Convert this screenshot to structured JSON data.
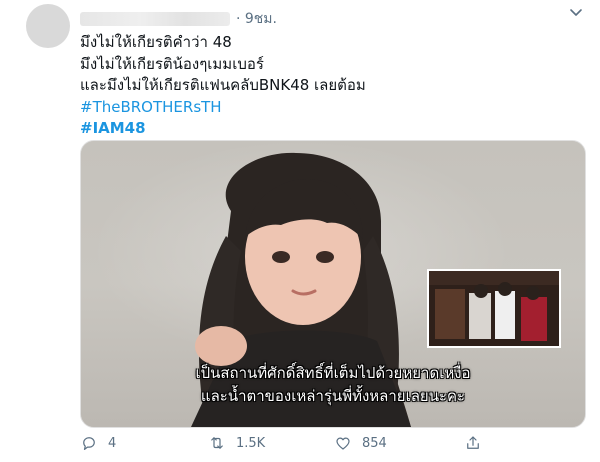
{
  "tweet": {
    "time": "· 9ชม.",
    "lines": [
      "มึงไม่ให้เกียรติคำว่า 48",
      "มึงไม่ให้เกียรติน้องๆเมมเบอร์",
      "และมึงไม่ให้เกียรติแฟนคลับBNK48 เลยต้อม"
    ],
    "hashtags": [
      "#TheBROTHERsTH",
      "#IAM48"
    ]
  },
  "media": {
    "subtitle_lines": [
      "เป็นสถานที่ศักดิ์สิทธิ์ที่เต็มไปด้วยหยาดเหงื่อ",
      "และน้ำตาของเหล่ารุ่นพี่ทั้งหลายเลยนะคะ"
    ]
  },
  "actions": {
    "reply_count": "4",
    "retweet_count": "1.5K",
    "like_count": "854"
  },
  "colors": {
    "hashtag": "#1b95e0",
    "muted": "#5b7083"
  },
  "icons": [
    "more-icon",
    "reply-icon",
    "retweet-icon",
    "like-icon",
    "share-icon"
  ]
}
